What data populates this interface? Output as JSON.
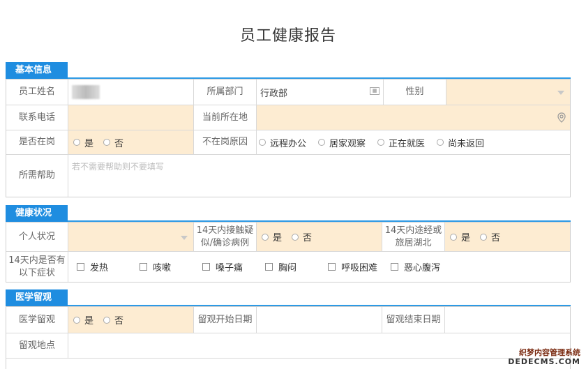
{
  "title": "员工健康报告",
  "sections": {
    "basic": "基本信息",
    "health": "健康状况",
    "medical": "医学留观"
  },
  "basic": {
    "employee_name_label": "员工姓名",
    "department_label": "所属部门",
    "department_value": "行政部",
    "gender_label": "性别",
    "phone_label": "联系电话",
    "location_label": "当前所在地",
    "on_duty_label": "是否在岗",
    "yes": "是",
    "no": "否",
    "absent_reason_label": "不在岗原因",
    "absent_reasons": [
      "远程办公",
      "居家观察",
      "正在就医",
      "尚未返回"
    ],
    "help_label": "所需帮助",
    "help_placeholder": "若不需要帮助则不要填写"
  },
  "health": {
    "personal_label": "个人状况",
    "contact_label": "14天内接触疑似/确诊病例",
    "hubei_label": "14天内途经或旅居湖北",
    "yes": "是",
    "no": "否",
    "symptoms_label": "14天内是否有以下症状",
    "symptoms": [
      "发热",
      "咳嗽",
      "嗓子痛",
      "胸闷",
      "呼吸困难",
      "恶心腹泻"
    ]
  },
  "medical": {
    "observe_label": "医学留观",
    "yes": "是",
    "no": "否",
    "start_label": "留观开始日期",
    "end_label": "留观结束日期",
    "place_label": "留观地点"
  },
  "watermark": {
    "line1": "织梦内容管理系统",
    "line2": "DEDECMS.COM"
  }
}
